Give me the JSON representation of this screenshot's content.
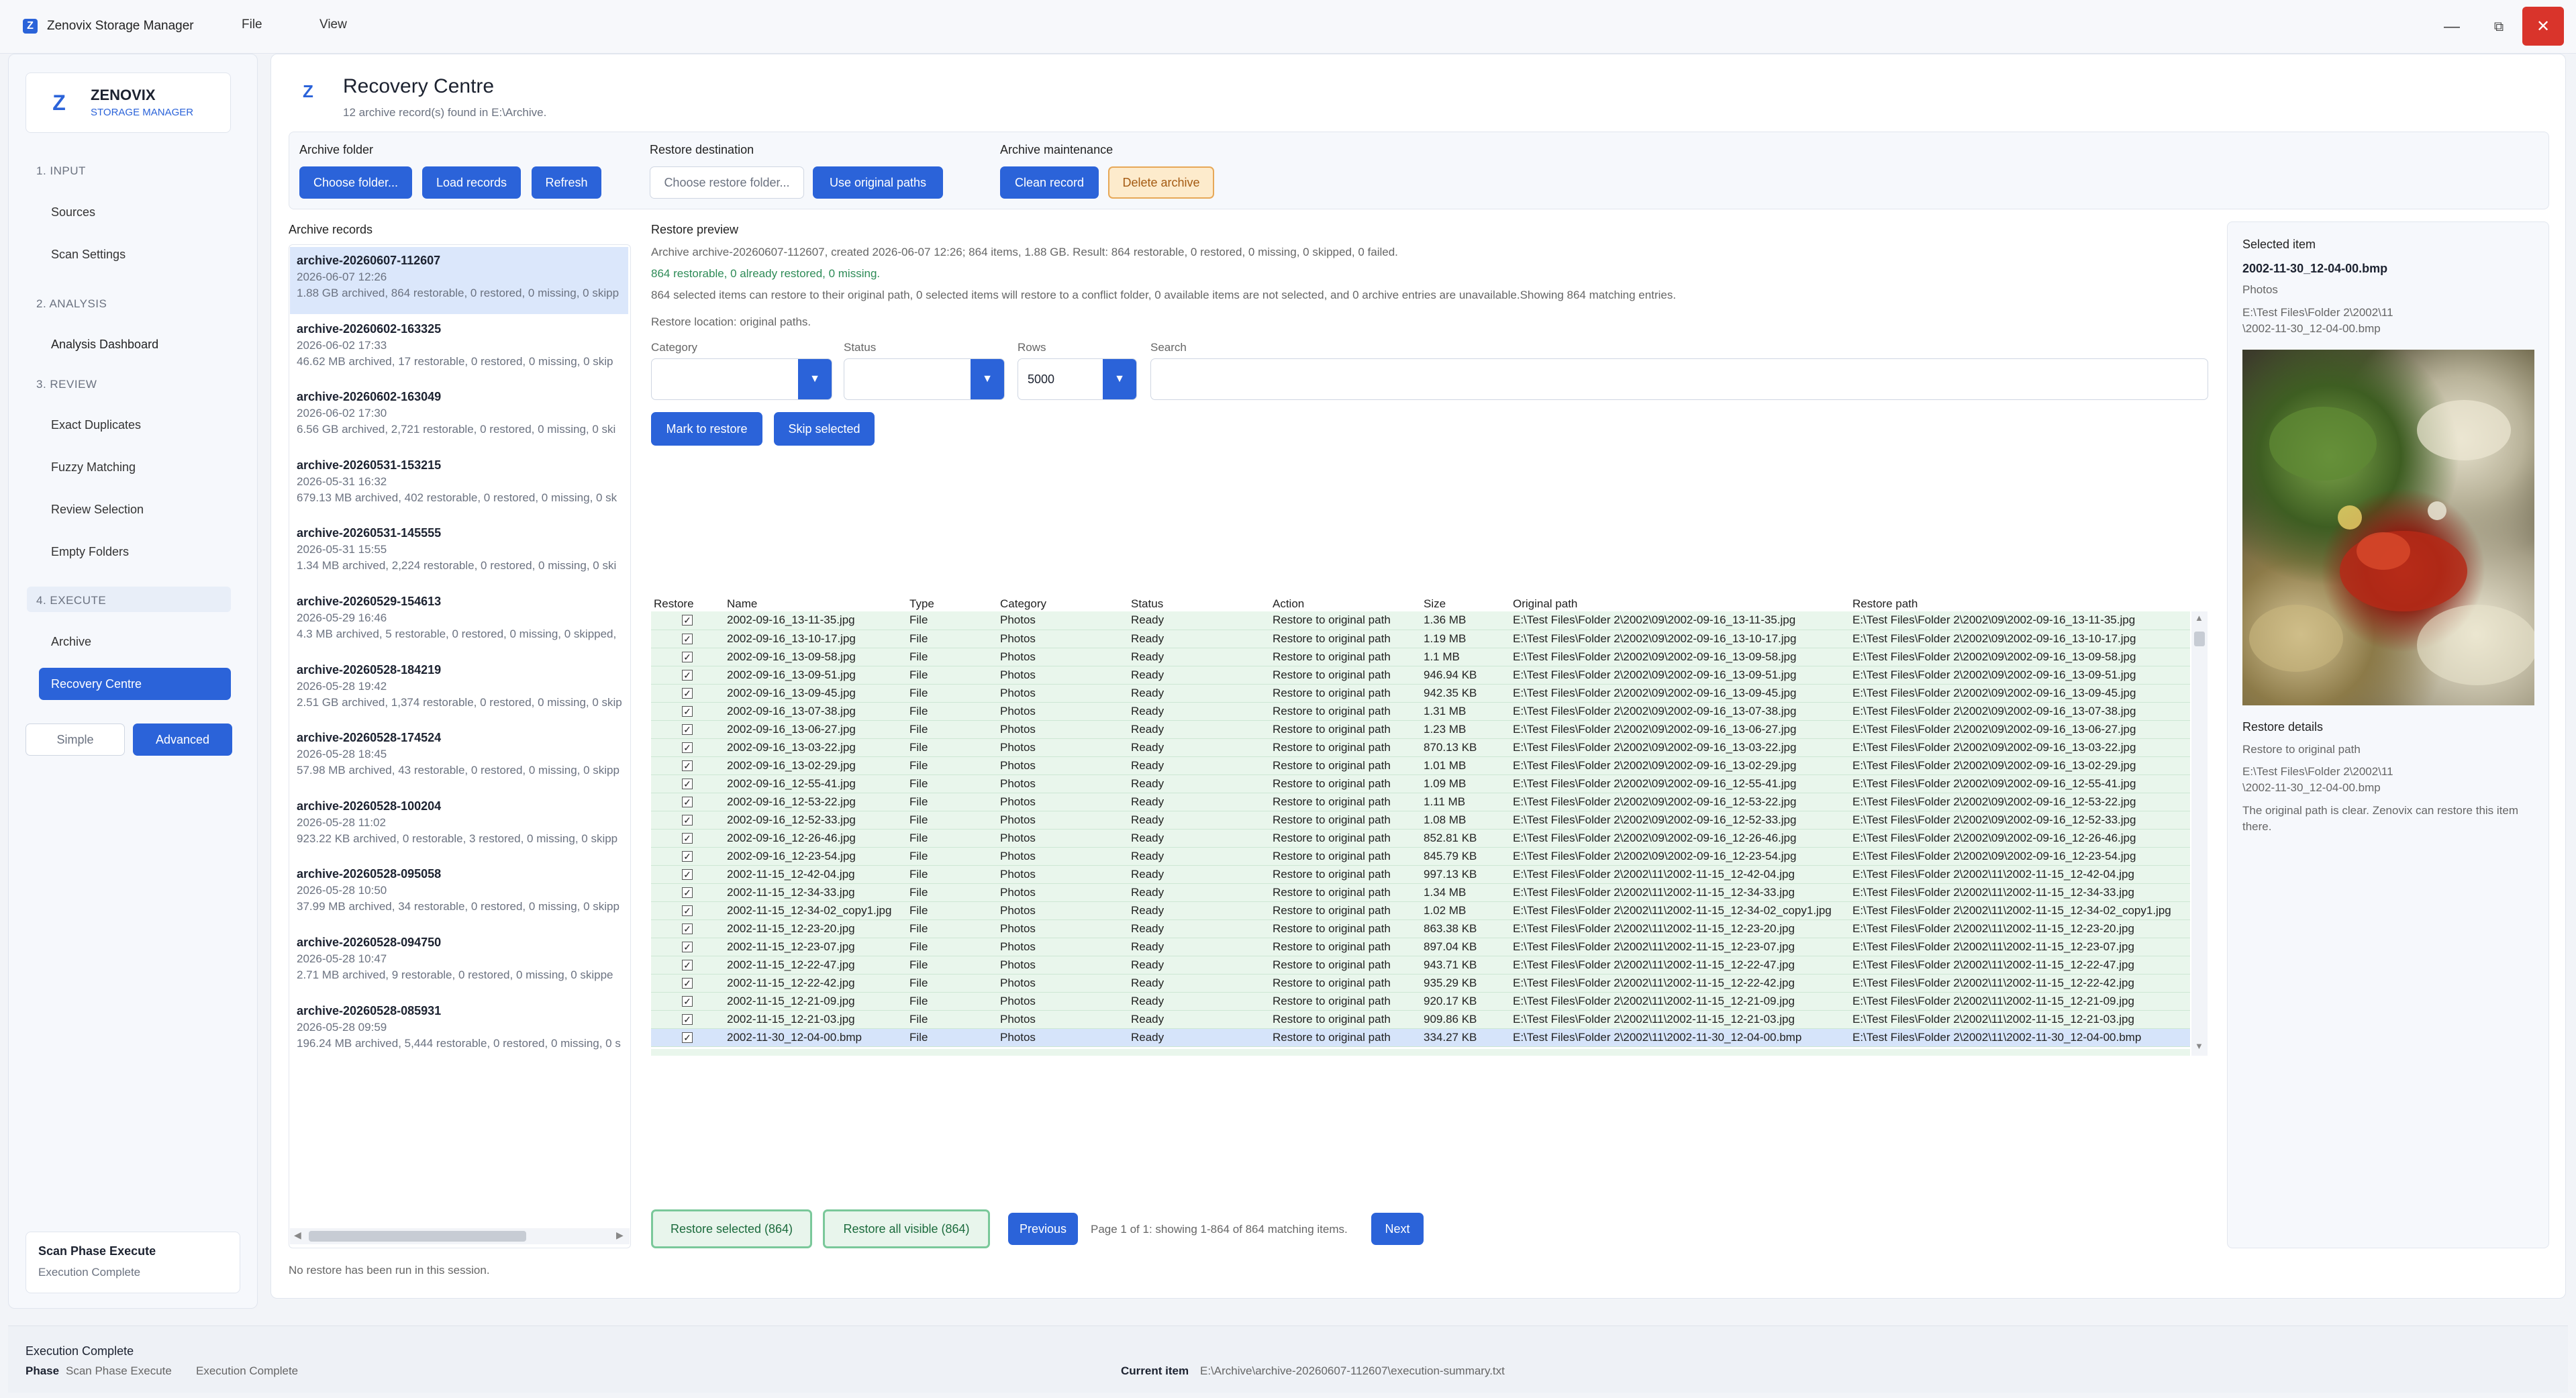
{
  "window": {
    "title": "Zenovix Storage Manager",
    "menu": [
      "File",
      "View"
    ]
  },
  "brand": {
    "name": "ZENOVIX",
    "sub": "STORAGE MANAGER"
  },
  "sidebar": {
    "sections": [
      {
        "label": "1. INPUT",
        "items": [
          "Sources",
          "Scan Settings"
        ]
      },
      {
        "label": "2. ANALYSIS",
        "items": [
          "Analysis Dashboard"
        ]
      },
      {
        "label": "3. REVIEW",
        "items": [
          "Exact Duplicates",
          "Fuzzy Matching",
          "Review Selection",
          "Empty Folders"
        ]
      },
      {
        "label": "4. EXECUTE",
        "items": [
          "Archive",
          "Recovery Centre"
        ]
      }
    ],
    "mode": {
      "simple": "Simple",
      "advanced": "Advanced"
    },
    "status": {
      "title": "Scan Phase Execute",
      "sub": "Execution Complete"
    }
  },
  "header": {
    "title": "Recovery Centre",
    "subtitle": "12 archive record(s) found in E:\\Archive."
  },
  "toolbar": {
    "folder_label": "Archive folder",
    "choose_folder": "Choose folder...",
    "load_records": "Load records",
    "refresh": "Refresh",
    "dest_label": "Restore destination",
    "choose_restore": "Choose restore folder...",
    "use_original": "Use original paths",
    "maint_label": "Archive maintenance",
    "clean_record": "Clean record",
    "delete_archive": "Delete archive"
  },
  "records": {
    "label": "Archive records",
    "items": [
      {
        "name": "archive-20260607-112607",
        "date": "2026-06-07 12:26",
        "summary": "1.88 GB archived, 864 restorable, 0 restored, 0 missing, 0 skipp"
      },
      {
        "name": "archive-20260602-163325",
        "date": "2026-06-02 17:33",
        "summary": "46.62 MB archived, 17 restorable, 0 restored, 0 missing, 0 skip"
      },
      {
        "name": "archive-20260602-163049",
        "date": "2026-06-02 17:30",
        "summary": "6.56 GB archived, 2,721 restorable, 0 restored, 0 missing, 0 ski"
      },
      {
        "name": "archive-20260531-153215",
        "date": "2026-05-31 16:32",
        "summary": "679.13 MB archived, 402 restorable, 0 restored, 0 missing, 0 sk"
      },
      {
        "name": "archive-20260531-145555",
        "date": "2026-05-31 15:55",
        "summary": "1.34 MB archived, 2,224 restorable, 0 restored, 0 missing, 0 ski"
      },
      {
        "name": "archive-20260529-154613",
        "date": "2026-05-29 16:46",
        "summary": "4.3 MB archived, 5 restorable, 0 restored, 0 missing, 0 skipped,"
      },
      {
        "name": "archive-20260528-184219",
        "date": "2026-05-28 19:42",
        "summary": "2.51 GB archived, 1,374 restorable, 0 restored, 0 missing, 0 skip"
      },
      {
        "name": "archive-20260528-174524",
        "date": "2026-05-28 18:45",
        "summary": "57.98 MB archived, 43 restorable, 0 restored, 0 missing, 0 skipp"
      },
      {
        "name": "archive-20260528-100204",
        "date": "2026-05-28 11:02",
        "summary": "923.22 KB archived, 0 restorable, 3 restored, 0 missing, 0 skipp"
      },
      {
        "name": "archive-20260528-095058",
        "date": "2026-05-28 10:50",
        "summary": "37.99 MB archived, 34 restorable, 0 restored, 0 missing, 0 skipp"
      },
      {
        "name": "archive-20260528-094750",
        "date": "2026-05-28 10:47",
        "summary": "2.71 MB archived, 9 restorable, 0 restored, 0 missing, 0 skippe"
      },
      {
        "name": "archive-20260528-085931",
        "date": "2026-05-28 09:59",
        "summary": "196.24 MB archived, 5,444 restorable, 0 restored, 0 missing, 0 s"
      }
    ],
    "no_restore": "No restore has been run in this session."
  },
  "preview": {
    "label": "Restore preview",
    "line1": "Archive archive-20260607-112607, created 2026-06-07 12:26; 864 items, 1.88 GB. Result: 864 restorable, 0 restored, 0 missing, 0 skipped, 0 failed.",
    "line2": "864 restorable, 0 already restored, 0 missing.",
    "line3": "864 selected items can restore to their original path, 0 selected items will restore to a conflict folder, 0 available items are not selected, and 0 archive entries are unavailable.Showing 864 matching entries.",
    "line4": "Restore location: original paths."
  },
  "filters": {
    "category_label": "Category",
    "category_value": "",
    "status_label": "Status",
    "status_value": "",
    "rows_label": "Rows",
    "rows_value": "5000",
    "search_label": "Search",
    "search_value": "",
    "mark": "Mark to restore",
    "skip": "Skip selected"
  },
  "table": {
    "columns": [
      "Restore",
      "Name",
      "Type",
      "Category",
      "Status",
      "Action",
      "Size",
      "Original path",
      "Restore path"
    ],
    "rows": [
      [
        "2002-09-16_13-11-35.jpg",
        "File",
        "Photos",
        "Ready",
        "Restore to original path",
        "1.36 MB",
        "E:\\Test Files\\Folder 2\\2002\\09\\2002-09-16_13-11-35.jpg",
        "E:\\Test Files\\Folder 2\\2002\\09\\2002-09-16_13-11-35.jpg"
      ],
      [
        "2002-09-16_13-10-17.jpg",
        "File",
        "Photos",
        "Ready",
        "Restore to original path",
        "1.19 MB",
        "E:\\Test Files\\Folder 2\\2002\\09\\2002-09-16_13-10-17.jpg",
        "E:\\Test Files\\Folder 2\\2002\\09\\2002-09-16_13-10-17.jpg"
      ],
      [
        "2002-09-16_13-09-58.jpg",
        "File",
        "Photos",
        "Ready",
        "Restore to original path",
        "1.1 MB",
        "E:\\Test Files\\Folder 2\\2002\\09\\2002-09-16_13-09-58.jpg",
        "E:\\Test Files\\Folder 2\\2002\\09\\2002-09-16_13-09-58.jpg"
      ],
      [
        "2002-09-16_13-09-51.jpg",
        "File",
        "Photos",
        "Ready",
        "Restore to original path",
        "946.94 KB",
        "E:\\Test Files\\Folder 2\\2002\\09\\2002-09-16_13-09-51.jpg",
        "E:\\Test Files\\Folder 2\\2002\\09\\2002-09-16_13-09-51.jpg"
      ],
      [
        "2002-09-16_13-09-45.jpg",
        "File",
        "Photos",
        "Ready",
        "Restore to original path",
        "942.35 KB",
        "E:\\Test Files\\Folder 2\\2002\\09\\2002-09-16_13-09-45.jpg",
        "E:\\Test Files\\Folder 2\\2002\\09\\2002-09-16_13-09-45.jpg"
      ],
      [
        "2002-09-16_13-07-38.jpg",
        "File",
        "Photos",
        "Ready",
        "Restore to original path",
        "1.31 MB",
        "E:\\Test Files\\Folder 2\\2002\\09\\2002-09-16_13-07-38.jpg",
        "E:\\Test Files\\Folder 2\\2002\\09\\2002-09-16_13-07-38.jpg"
      ],
      [
        "2002-09-16_13-06-27.jpg",
        "File",
        "Photos",
        "Ready",
        "Restore to original path",
        "1.23 MB",
        "E:\\Test Files\\Folder 2\\2002\\09\\2002-09-16_13-06-27.jpg",
        "E:\\Test Files\\Folder 2\\2002\\09\\2002-09-16_13-06-27.jpg"
      ],
      [
        "2002-09-16_13-03-22.jpg",
        "File",
        "Photos",
        "Ready",
        "Restore to original path",
        "870.13 KB",
        "E:\\Test Files\\Folder 2\\2002\\09\\2002-09-16_13-03-22.jpg",
        "E:\\Test Files\\Folder 2\\2002\\09\\2002-09-16_13-03-22.jpg"
      ],
      [
        "2002-09-16_13-02-29.jpg",
        "File",
        "Photos",
        "Ready",
        "Restore to original path",
        "1.01 MB",
        "E:\\Test Files\\Folder 2\\2002\\09\\2002-09-16_13-02-29.jpg",
        "E:\\Test Files\\Folder 2\\2002\\09\\2002-09-16_13-02-29.jpg"
      ],
      [
        "2002-09-16_12-55-41.jpg",
        "File",
        "Photos",
        "Ready",
        "Restore to original path",
        "1.09 MB",
        "E:\\Test Files\\Folder 2\\2002\\09\\2002-09-16_12-55-41.jpg",
        "E:\\Test Files\\Folder 2\\2002\\09\\2002-09-16_12-55-41.jpg"
      ],
      [
        "2002-09-16_12-53-22.jpg",
        "File",
        "Photos",
        "Ready",
        "Restore to original path",
        "1.11 MB",
        "E:\\Test Files\\Folder 2\\2002\\09\\2002-09-16_12-53-22.jpg",
        "E:\\Test Files\\Folder 2\\2002\\09\\2002-09-16_12-53-22.jpg"
      ],
      [
        "2002-09-16_12-52-33.jpg",
        "File",
        "Photos",
        "Ready",
        "Restore to original path",
        "1.08 MB",
        "E:\\Test Files\\Folder 2\\2002\\09\\2002-09-16_12-52-33.jpg",
        "E:\\Test Files\\Folder 2\\2002\\09\\2002-09-16_12-52-33.jpg"
      ],
      [
        "2002-09-16_12-26-46.jpg",
        "File",
        "Photos",
        "Ready",
        "Restore to original path",
        "852.81 KB",
        "E:\\Test Files\\Folder 2\\2002\\09\\2002-09-16_12-26-46.jpg",
        "E:\\Test Files\\Folder 2\\2002\\09\\2002-09-16_12-26-46.jpg"
      ],
      [
        "2002-09-16_12-23-54.jpg",
        "File",
        "Photos",
        "Ready",
        "Restore to original path",
        "845.79 KB",
        "E:\\Test Files\\Folder 2\\2002\\09\\2002-09-16_12-23-54.jpg",
        "E:\\Test Files\\Folder 2\\2002\\09\\2002-09-16_12-23-54.jpg"
      ],
      [
        "2002-11-15_12-42-04.jpg",
        "File",
        "Photos",
        "Ready",
        "Restore to original path",
        "997.13 KB",
        "E:\\Test Files\\Folder 2\\2002\\11\\2002-11-15_12-42-04.jpg",
        "E:\\Test Files\\Folder 2\\2002\\11\\2002-11-15_12-42-04.jpg"
      ],
      [
        "2002-11-15_12-34-33.jpg",
        "File",
        "Photos",
        "Ready",
        "Restore to original path",
        "1.34 MB",
        "E:\\Test Files\\Folder 2\\2002\\11\\2002-11-15_12-34-33.jpg",
        "E:\\Test Files\\Folder 2\\2002\\11\\2002-11-15_12-34-33.jpg"
      ],
      [
        "2002-11-15_12-34-02_copy1.jpg",
        "File",
        "Photos",
        "Ready",
        "Restore to original path",
        "1.02 MB",
        "E:\\Test Files\\Folder 2\\2002\\11\\2002-11-15_12-34-02_copy1.jpg",
        "E:\\Test Files\\Folder 2\\2002\\11\\2002-11-15_12-34-02_copy1.jpg"
      ],
      [
        "2002-11-15_12-23-20.jpg",
        "File",
        "Photos",
        "Ready",
        "Restore to original path",
        "863.38 KB",
        "E:\\Test Files\\Folder 2\\2002\\11\\2002-11-15_12-23-20.jpg",
        "E:\\Test Files\\Folder 2\\2002\\11\\2002-11-15_12-23-20.jpg"
      ],
      [
        "2002-11-15_12-23-07.jpg",
        "File",
        "Photos",
        "Ready",
        "Restore to original path",
        "897.04 KB",
        "E:\\Test Files\\Folder 2\\2002\\11\\2002-11-15_12-23-07.jpg",
        "E:\\Test Files\\Folder 2\\2002\\11\\2002-11-15_12-23-07.jpg"
      ],
      [
        "2002-11-15_12-22-47.jpg",
        "File",
        "Photos",
        "Ready",
        "Restore to original path",
        "943.71 KB",
        "E:\\Test Files\\Folder 2\\2002\\11\\2002-11-15_12-22-47.jpg",
        "E:\\Test Files\\Folder 2\\2002\\11\\2002-11-15_12-22-47.jpg"
      ],
      [
        "2002-11-15_12-22-42.jpg",
        "File",
        "Photos",
        "Ready",
        "Restore to original path",
        "935.29 KB",
        "E:\\Test Files\\Folder 2\\2002\\11\\2002-11-15_12-22-42.jpg",
        "E:\\Test Files\\Folder 2\\2002\\11\\2002-11-15_12-22-42.jpg"
      ],
      [
        "2002-11-15_12-21-09.jpg",
        "File",
        "Photos",
        "Ready",
        "Restore to original path",
        "920.17 KB",
        "E:\\Test Files\\Folder 2\\2002\\11\\2002-11-15_12-21-09.jpg",
        "E:\\Test Files\\Folder 2\\2002\\11\\2002-11-15_12-21-09.jpg"
      ],
      [
        "2002-11-15_12-21-03.jpg",
        "File",
        "Photos",
        "Ready",
        "Restore to original path",
        "909.86 KB",
        "E:\\Test Files\\Folder 2\\2002\\11\\2002-11-15_12-21-03.jpg",
        "E:\\Test Files\\Folder 2\\2002\\11\\2002-11-15_12-21-03.jpg"
      ],
      [
        "2002-11-30_12-04-00.bmp",
        "File",
        "Photos",
        "Ready",
        "Restore to original path",
        "334.27 KB",
        "E:\\Test Files\\Folder 2\\2002\\11\\2002-11-30_12-04-00.bmp",
        "E:\\Test Files\\Folder 2\\2002\\11\\2002-11-30_12-04-00.bmp"
      ]
    ]
  },
  "bottom": {
    "restore_selected": "Restore selected (864)",
    "restore_visible": "Restore all visible (864)",
    "previous": "Previous",
    "page_info": "Page 1 of 1: showing 1-864 of 864 matching items.",
    "next": "Next"
  },
  "details": {
    "label": "Selected item",
    "name": "2002-11-30_12-04-00.bmp",
    "category": "Photos",
    "path1": "E:\\Test Files\\Folder 2\\2002\\11",
    "path2": "\\2002-11-30_12-04-00.bmp",
    "restore_label": "Restore details",
    "restore_mode": "Restore to original path",
    "rpath1": "E:\\Test Files\\Folder 2\\2002\\11",
    "rpath2": "\\2002-11-30_12-04-00.bmp",
    "note": "The original path is clear. Zenovix can restore this item there."
  },
  "footer": {
    "title": "Execution Complete",
    "phase_label": "Phase",
    "phase_value": "Scan Phase Execute",
    "phase_status": "Execution Complete",
    "current_label": "Current item",
    "current_value": "E:\\Archive\\archive-20260607-112607\\execution-summary.txt"
  },
  "colors": {
    "accent": "#2b63d9",
    "row_ready": "#e9f6ec",
    "row_selected": "#d6e4fa",
    "close": "#d9342b"
  }
}
